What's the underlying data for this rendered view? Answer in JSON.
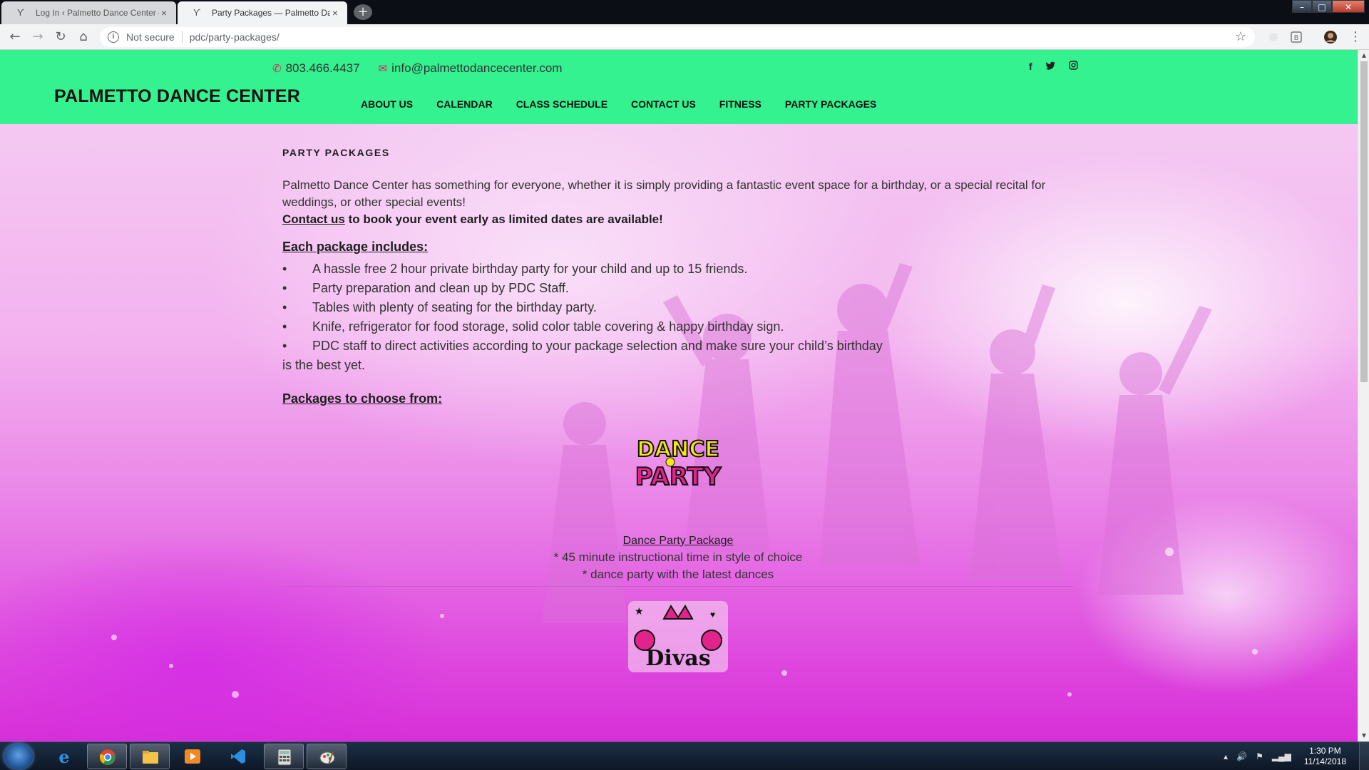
{
  "browser": {
    "tabs": [
      {
        "title": "Log In ‹ Palmetto Dance Center —",
        "active": false
      },
      {
        "title": "Party Packages — Palmetto Dance",
        "active": true
      }
    ],
    "new_tab_label": "+",
    "security_label": "Not secure",
    "url": "pdc/party-packages/"
  },
  "site": {
    "phone": "803.466.4437",
    "email": "info@palmettodancecenter.com",
    "social": [
      "f",
      "t",
      "ig"
    ],
    "logo": "PALMETTO DANCE CENTER",
    "nav": [
      "ABOUT US",
      "CALENDAR",
      "CLASS SCHEDULE",
      "CONTACT US",
      "FITNESS",
      "PARTY PACKAGES"
    ],
    "colors": {
      "header_bg": "#33f28f",
      "icon_accent": "#e0245e",
      "page_bg_pink": "#ea86e8"
    }
  },
  "page": {
    "heading": "PARTY PACKAGES",
    "intro": "Palmetto Dance Center has something for everyone, whether it is simply providing a fantastic event space for a birthday, or a special recital for weddings, or other special events!",
    "contact_link": "Contact us",
    "contact_rest": " to book your event early as limited dates are available!",
    "includes_heading": "Each package includes:",
    "includes": [
      "A hassle free 2 hour private birthday party for your child and up to 15 friends.",
      "Party preparation and clean up by PDC Staff.",
      "Tables with plenty of seating for the birthday party.",
      "Knife, refrigerator for food storage, solid color table covering & happy birthday sign.",
      "PDC staff to direct activities according to your package selection and make sure your child’s birthday",
      "is the best yet."
    ],
    "packages_heading": "Packages to choose from:",
    "packages": [
      {
        "logo_text": [
          "DANCE",
          "PARTY"
        ],
        "name": "Dance Party Package",
        "lines": [
          "* 45 minute instructional time in style of choice",
          "* dance party with the latest dances"
        ]
      },
      {
        "logo_text": [
          "Divas"
        ]
      }
    ]
  },
  "taskbar": {
    "apps": [
      "start",
      "internet-explorer",
      "chrome",
      "file-explorer",
      "media-player",
      "visual-studio-code",
      "calculator",
      "paint"
    ],
    "time": "1:30 PM",
    "date": "11/14/2018"
  }
}
